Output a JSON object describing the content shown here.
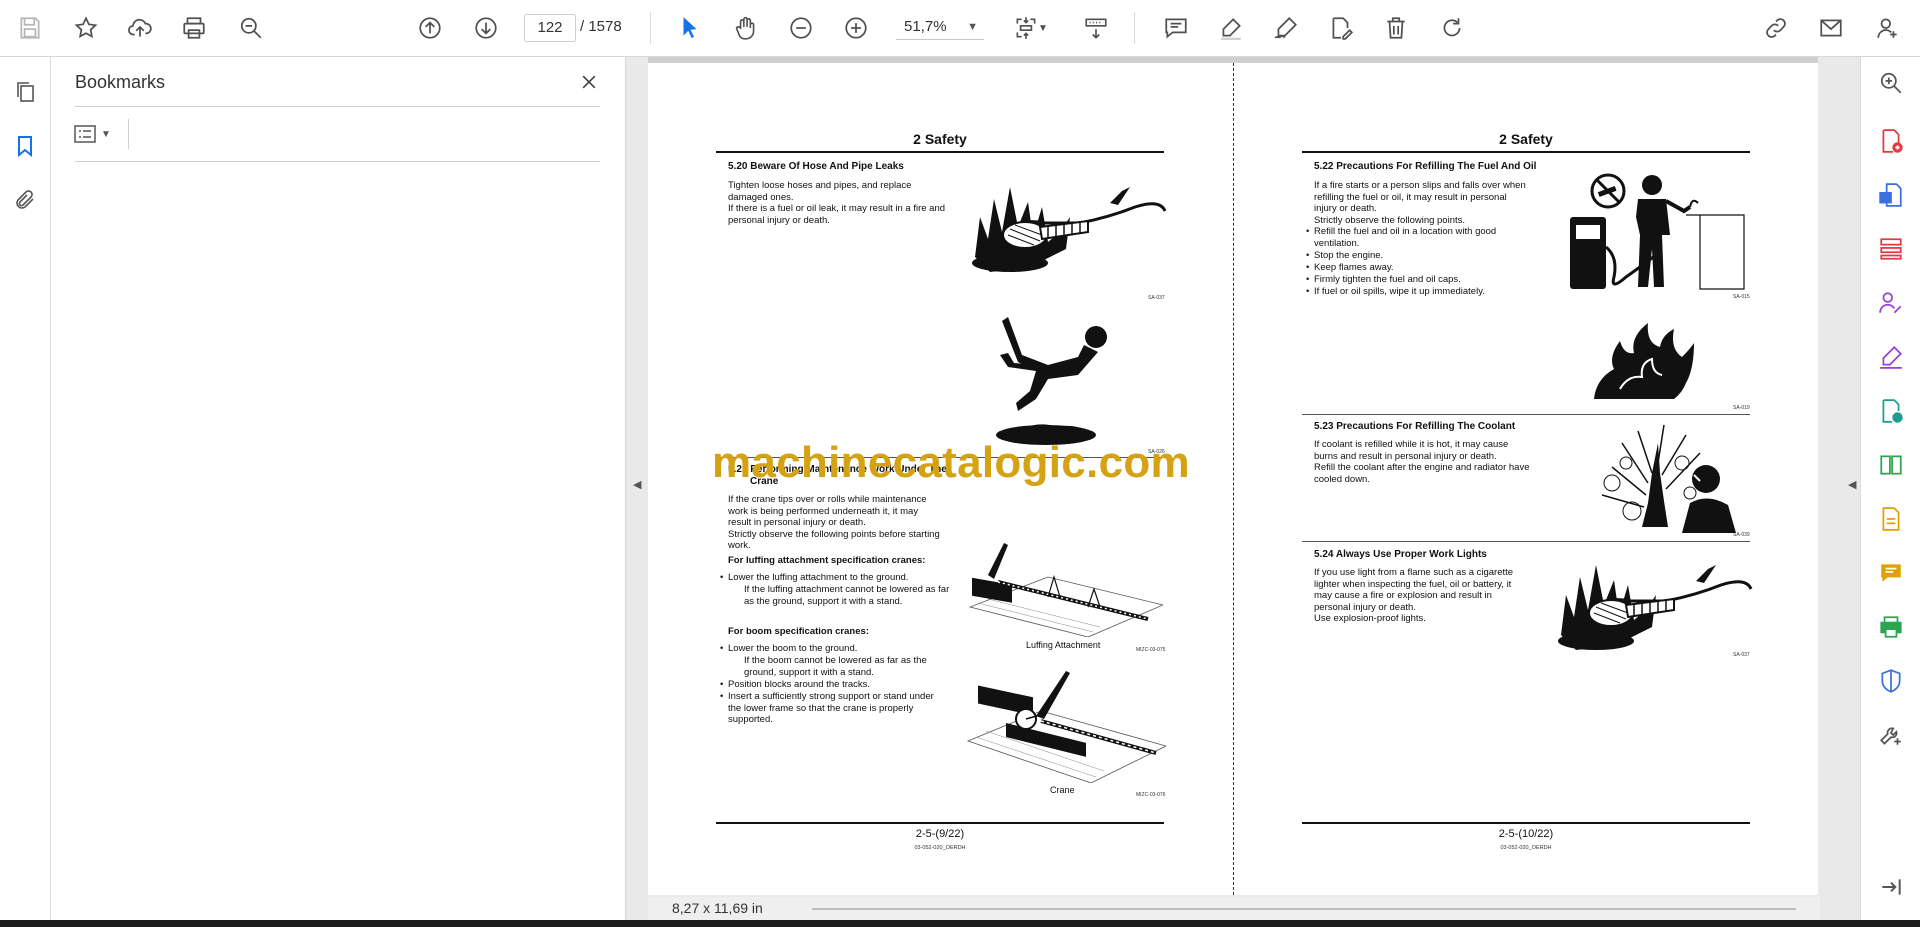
{
  "toolbar": {
    "page_current": "122",
    "page_total": "/ 1578",
    "zoom": "51,7%"
  },
  "bookmarks": {
    "title": "Bookmarks"
  },
  "document": {
    "watermark": "machinecatalogic.com",
    "page_size": "8,27 x 11,69 in",
    "left_page": {
      "header": "2 Safety",
      "s520_title": "5.20 Beware Of Hose And Pipe Leaks",
      "s520_body": "Tighten loose hoses and pipes, and replace\ndamaged ones.\nIf there is a fuel or oil leak, it may result in a fire and\npersonal injury or death.",
      "s520_code": "SA-037",
      "fall_code": "SA-026",
      "s521_title_1": "5.21 Performing Maintenance Work Under The",
      "s521_title_2": "Crane",
      "s521_body": "If the crane tips over or rolls while maintenance\nwork is being performed underneath it, it may\nresult in personal injury or death.\nStrictly observe the following points before starting\nwork.",
      "luffing_head": "For luffing attachment specification cranes:",
      "luffing_b1": "Lower the luffing attachment to the ground.",
      "luffing_sub": "If the luffing attachment cannot be lowered as far\nas the ground, support it with a stand.",
      "luffing_caption": "Luffing Attachment",
      "luffing_code": "MIZC-03-075",
      "boom_head": "For boom specification cranes:",
      "boom_b1": "Lower the boom to the ground.",
      "boom_sub": "If the boom cannot be lowered as far as the\nground, support it with a stand.",
      "boom_b2": "Position blocks around the tracks.",
      "boom_b3": "Insert a sufficiently strong support or stand under\nthe lower frame so that the crane is properly\nsupported.",
      "crane_caption": "Crane",
      "crane_code": "MIZC-03-076",
      "footer": "2-5-(9/22)",
      "footer_code": "03-052-020_OERDH"
    },
    "right_page": {
      "header": "2 Safety",
      "s522_title": "5.22 Precautions For Refilling The Fuel And Oil",
      "s522_body": "If a fire starts or a person slips and falls over when\nrefilling the fuel or oil, it may result in personal\ninjury or death.\nStrictly observe the following points.",
      "s522_b1": "Refill the fuel and oil in a location with good\nventilation.",
      "s522_b2": "Stop the engine.",
      "s522_b3": "Keep flames away.",
      "s522_b4": "Firmly tighten the fuel and oil caps.",
      "s522_b5": "If fuel or oil spills, wipe it up immediately.",
      "s522_code": "SA-015",
      "flame_code": "SA-019",
      "s523_title": "5.23 Precautions For Refilling The Coolant",
      "s523_body": "If coolant is refilled while it is hot, it may cause\nburns and result in personal injury or death.\nRefill the coolant after the engine and radiator have\ncooled down.",
      "s523_code": "SA-039",
      "s524_title": "5.24 Always Use Proper Work Lights",
      "s524_body": "If you use light from a flame such as a cigarette\nlighter when inspecting the fuel, oil or battery, it\nmay cause a fire or explosion and result in\npersonal injury or death.\nUse explosion-proof lights.",
      "s524_code": "SA-037",
      "footer": "2-5-(10/22)",
      "footer_code": "03-052-020_OERDH"
    }
  }
}
